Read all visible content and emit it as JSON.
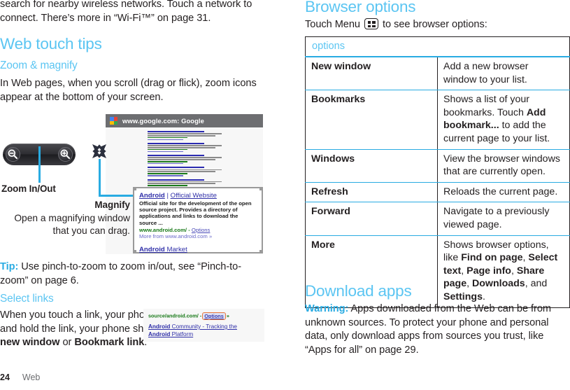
{
  "left": {
    "intro_paragraph": "search for nearby wireless networks. Touch a network to connect. There’s more in “Wi-Fi™” on page 31.",
    "section_web_touch_tips": "Web touch tips",
    "subsection_zoom_magnify": "Zoom & magnify",
    "zoom_paragraph": "In Web pages, when you scroll (drag or flick), zoom icons appear at the bottom of your screen.",
    "figure_zoom": {
      "phone_title": "www.google.com: Google",
      "favicon_name": "google-favicon",
      "zoom_label": "Zoom In/Out",
      "magnify_label": "Magnify",
      "magnify_description": "Open a magnifying window that you can drag.",
      "magnified_result": {
        "title_bold": "Android",
        "title_sep": " | ",
        "title_plain": "Official Website",
        "description": "Official site for the development of the open source project. Provides a directory of applications and links to download the source ...",
        "url": "www.android.com/",
        "url_sep": " - ",
        "url_options": "Options",
        "more_from": "More from www.android.com »",
        "market_bold": "Android",
        "market_plain": " Market"
      }
    },
    "tip_label": "Tip:",
    "tip_text": " Use pinch-to-zoom to zoom in/out, see “Pinch-to-zoom” on page 6.",
    "subsection_select_links": "Select links",
    "select_para_1": "When you touch a link, your phone outlines it. If you touch and hold the link, your phone shows options, like ",
    "select_para_bold_1": "Open in new window",
    "select_para_2": " or ",
    "select_para_bold_2": "Bookmark link",
    "select_para_3": ".",
    "figure_links": {
      "url": "source/android.com/ -",
      "options_chip": "Options",
      "url_trail": "»",
      "result_title_a": "Android",
      "result_title_b": " Community - Tracking the ",
      "result_title_c": "Android",
      "result_title_d": " Platform"
    },
    "footer_page_number": "24",
    "footer_chapter": "Web"
  },
  "right": {
    "section_browser_options": "Browser options",
    "browser_lead_before": "Touch Menu ",
    "menu_icon_name": "menu-icon",
    "browser_lead_after": " to see browser options:",
    "table": {
      "header": "options",
      "rows": [
        {
          "name": "New window",
          "description": "Add a new browser window to your list."
        },
        {
          "name": "Bookmarks",
          "desc_part_1": "Shows a list of your bookmarks. Touch ",
          "desc_bold_1": "Add bookmark...",
          "desc_part_2": " to add the current page to your list."
        },
        {
          "name": "Windows",
          "description": "View the browser windows that are currently open."
        },
        {
          "name": "Refresh",
          "description": "Reloads the current page."
        },
        {
          "name": "Forward",
          "description": "Navigate to a previously viewed page."
        },
        {
          "name": "More",
          "desc_part_1": "Shows browser options, like ",
          "desc_bold_1": "Find on page",
          "desc_sep_1": ", ",
          "desc_bold_2": "Select text",
          "desc_sep_2": ", ",
          "desc_bold_3": "Page info",
          "desc_sep_3": ", ",
          "desc_bold_4": "Share page",
          "desc_sep_4": ", ",
          "desc_bold_5": "Downloads",
          "desc_sep_5": ", and ",
          "desc_bold_6": "Settings",
          "desc_end": "."
        }
      ]
    },
    "section_download_apps": "Download apps",
    "warning_label": "Warning:",
    "warning_text": " Apps downloaded from the Web can be from unknown sources. To protect your phone and personal data, only download apps from sources you trust, like “Apps for all” on page 29."
  },
  "colors": {
    "accent_blue": "#5bc5f2",
    "lead_blue": "#29abe2",
    "body_text": "#231f20",
    "footer_gray": "#6d6e71"
  }
}
